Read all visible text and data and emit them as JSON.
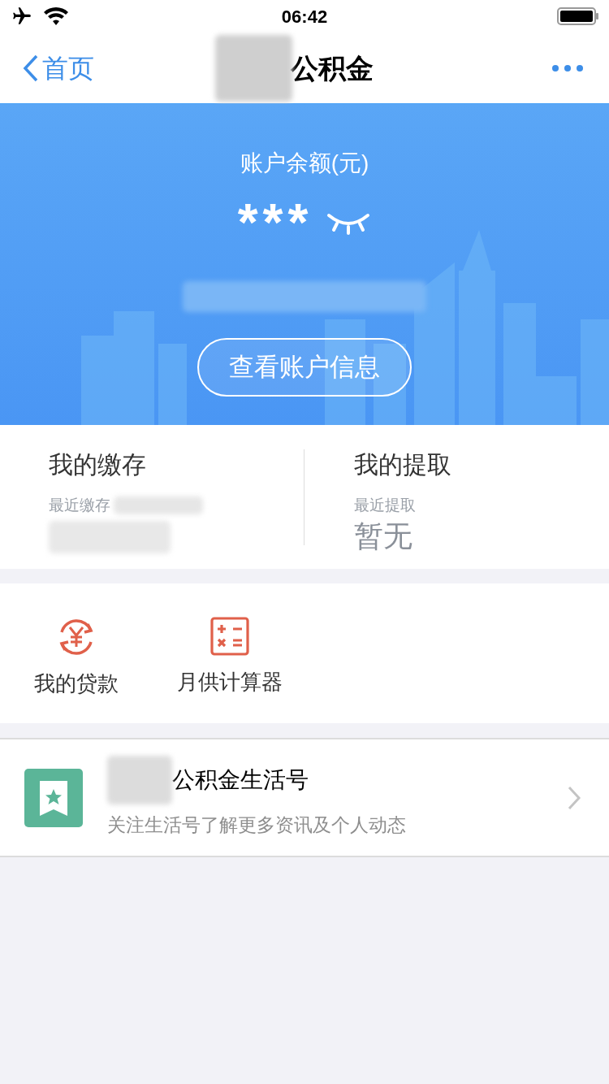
{
  "status_bar": {
    "time": "06:42"
  },
  "nav": {
    "back": "首页",
    "title": "公积金"
  },
  "balance": {
    "label": "账户余额(元)",
    "value": "***",
    "button": "查看账户信息"
  },
  "summary": [
    {
      "title": "我的缴存",
      "caption": "最近缴存"
    },
    {
      "title": "我的提取",
      "caption": "最近提取",
      "value": "暂无"
    }
  ],
  "tools": [
    {
      "kind": "loan",
      "label": "我的贷款"
    },
    {
      "kind": "calculator",
      "label": "月供计算器"
    }
  ],
  "life_account": {
    "title": "公积金生活号",
    "subtitle": "关注生活号了解更多资讯及个人动态"
  }
}
